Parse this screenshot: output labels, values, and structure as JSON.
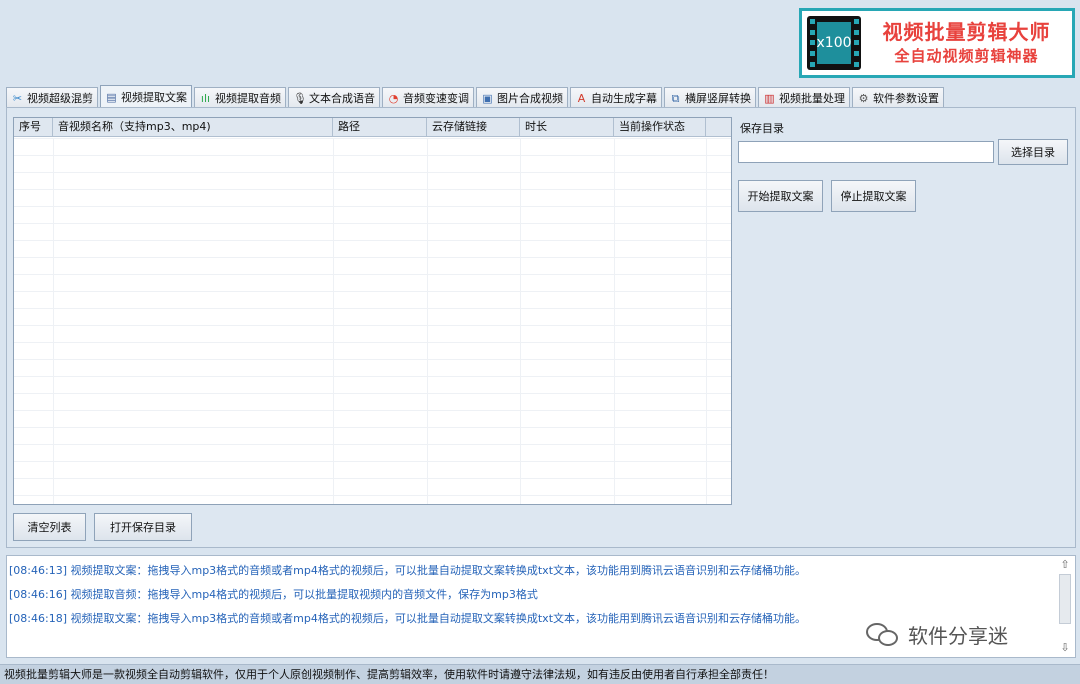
{
  "banner": {
    "badge": "x100",
    "title": "视频批量剪辑大师",
    "subtitle": "全自动视频剪辑神器"
  },
  "tabs": [
    {
      "label": "视频超级混剪",
      "icon": "scissors-icon",
      "glyph": "✂",
      "color": "#2a7fc7"
    },
    {
      "label": "视频提取文案",
      "icon": "document-icon",
      "glyph": "▤",
      "color": "#4a6aa0"
    },
    {
      "label": "视频提取音频",
      "icon": "waveform-icon",
      "glyph": "ılı",
      "color": "#2aa84a"
    },
    {
      "label": "文本合成语音",
      "icon": "microphone-icon",
      "glyph": "🎙",
      "color": "#333333"
    },
    {
      "label": "音频变速变调",
      "icon": "gauge-icon",
      "glyph": "◔",
      "color": "#e04030"
    },
    {
      "label": "图片合成视频",
      "icon": "image-icon",
      "glyph": "▣",
      "color": "#3f6fb0"
    },
    {
      "label": "自动生成字幕",
      "icon": "font-icon",
      "glyph": "A",
      "color": "#d23a2a"
    },
    {
      "label": "横屏竖屏转换",
      "icon": "rotate-screen-icon",
      "glyph": "⧉",
      "color": "#3a6aa8"
    },
    {
      "label": "视频批量处理",
      "icon": "film-icon",
      "glyph": "▥",
      "color": "#cc2a2a"
    },
    {
      "label": "软件参数设置",
      "icon": "gear-icon",
      "glyph": "⚙",
      "color": "#555555"
    }
  ],
  "active_tab": 1,
  "table": {
    "columns": [
      "序号",
      "音视频名称（支持mp3、mp4)",
      "路径",
      "云存储链接",
      "时长",
      "当前操作状态",
      ""
    ]
  },
  "save_dir": {
    "label": "保存目录",
    "value": "",
    "choose_button": "选择目录"
  },
  "actions": {
    "start": "开始提取文案",
    "stop": "停止提取文案",
    "clear": "清空列表",
    "open_dir": "打开保存目录"
  },
  "log": [
    "[08:46:13] 视频提取文案：拖拽导入mp3格式的音频或者mp4格式的视频后，可以批量自动提取文案转换成txt文本，该功能用到腾讯云语音识别和云存储桶功能。",
    "[08:46:16] 视频提取音频：拖拽导入mp4格式的视频后，可以批量提取视频内的音频文件，保存为mp3格式",
    "[08:46:18] 视频提取文案：拖拽导入mp3格式的音频或者mp4格式的视频后，可以批量自动提取文案转换成txt文本，该功能用到腾讯云语音识别和云存储桶功能。"
  ],
  "watermark": "软件分享迷",
  "status_bar": "视频批量剪辑大师是一款视频全自动剪辑软件，仅用于个人原创视频制作、提高剪辑效率，使用软件时请遵守法律法规，如有违反由使用者自行承担全部责任！"
}
